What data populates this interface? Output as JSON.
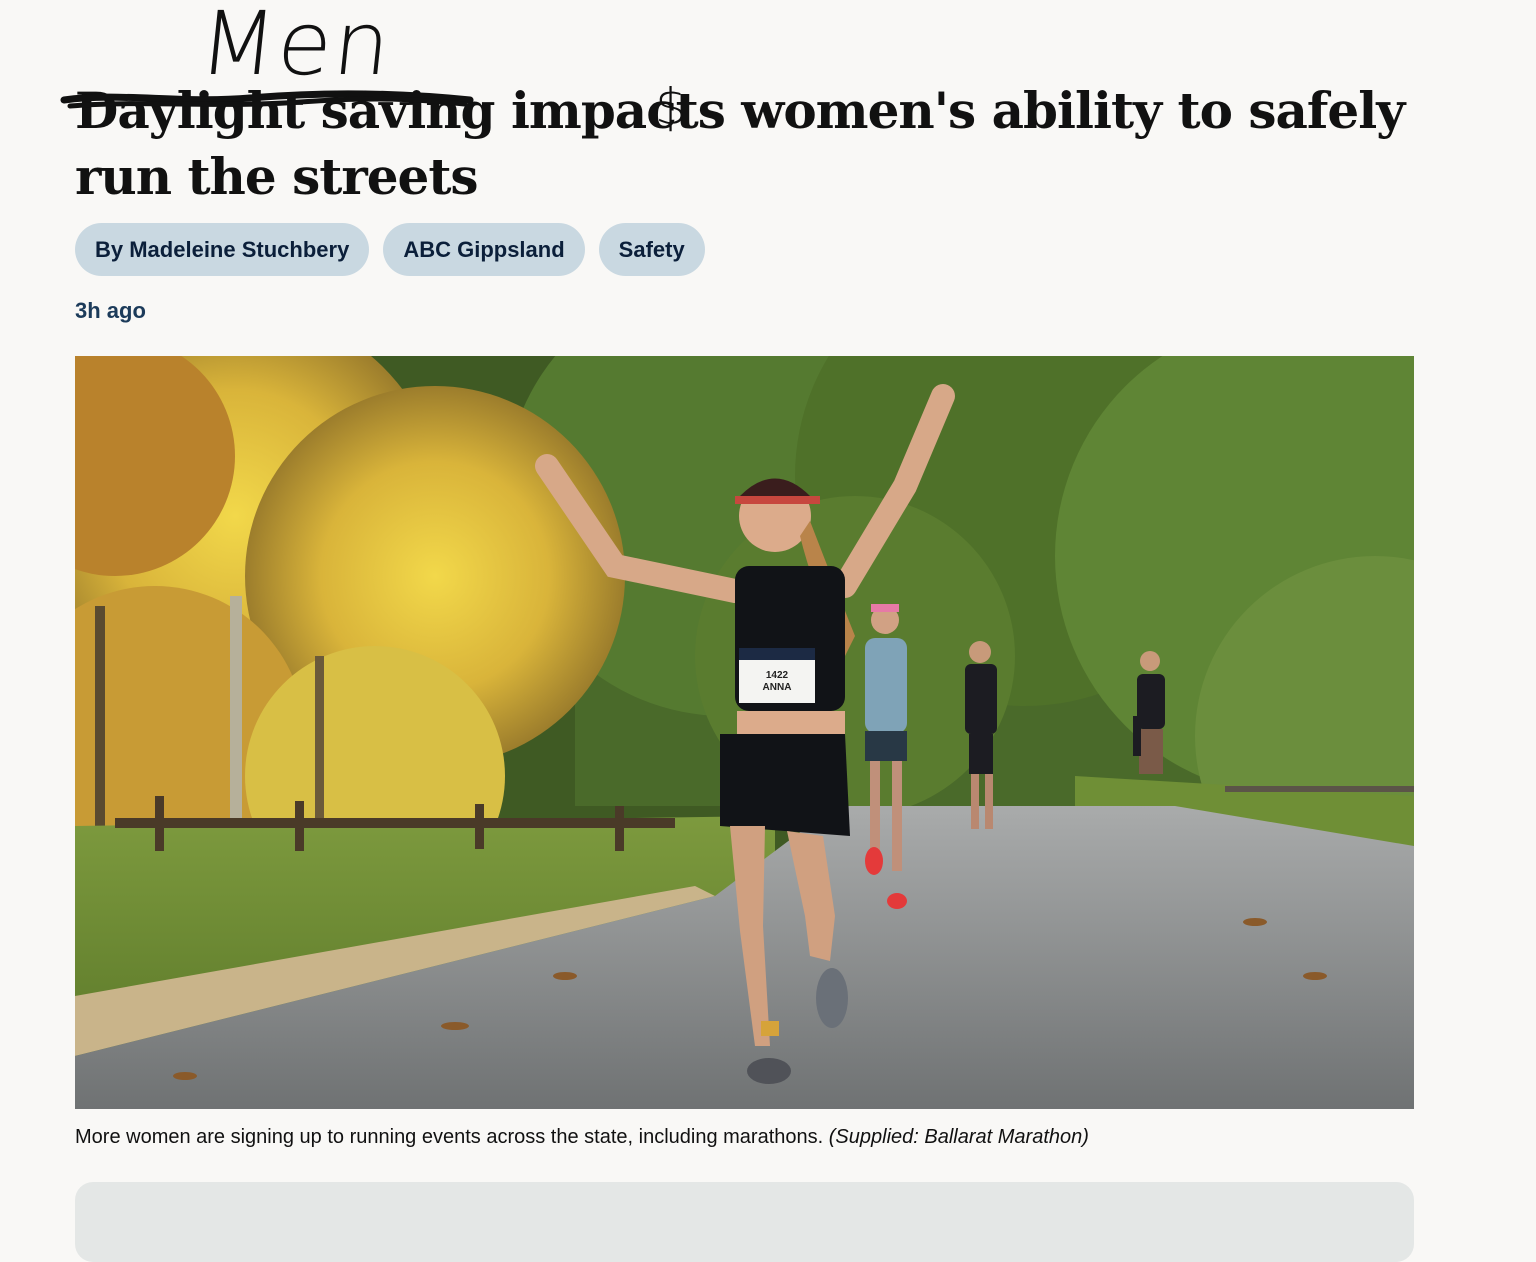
{
  "article": {
    "handwritten_word": "Men",
    "headline_struck": "Daylight saving",
    "headline_rest": " impacts women's ability to safely run the streets",
    "handwritten_mark": "$",
    "tags": [
      {
        "label": "By Madeleine Stuchbery"
      },
      {
        "label": "ABC Gippsland"
      },
      {
        "label": "Safety"
      }
    ],
    "timestamp": "3h ago",
    "caption": "More women are signing up to running events across the state, including marathons.",
    "caption_credit": "(Supplied: Ballarat Marathon)"
  },
  "photo": {
    "bib_line1": "1422",
    "bib_line2": "ANNA"
  },
  "colors": {
    "tag_bg": "#c9d8e1",
    "tag_text": "#0b1f3a",
    "timestamp": "#1c3b5a",
    "page_bg": "#f9f8f6",
    "card_bg": "#e4e7e6"
  }
}
